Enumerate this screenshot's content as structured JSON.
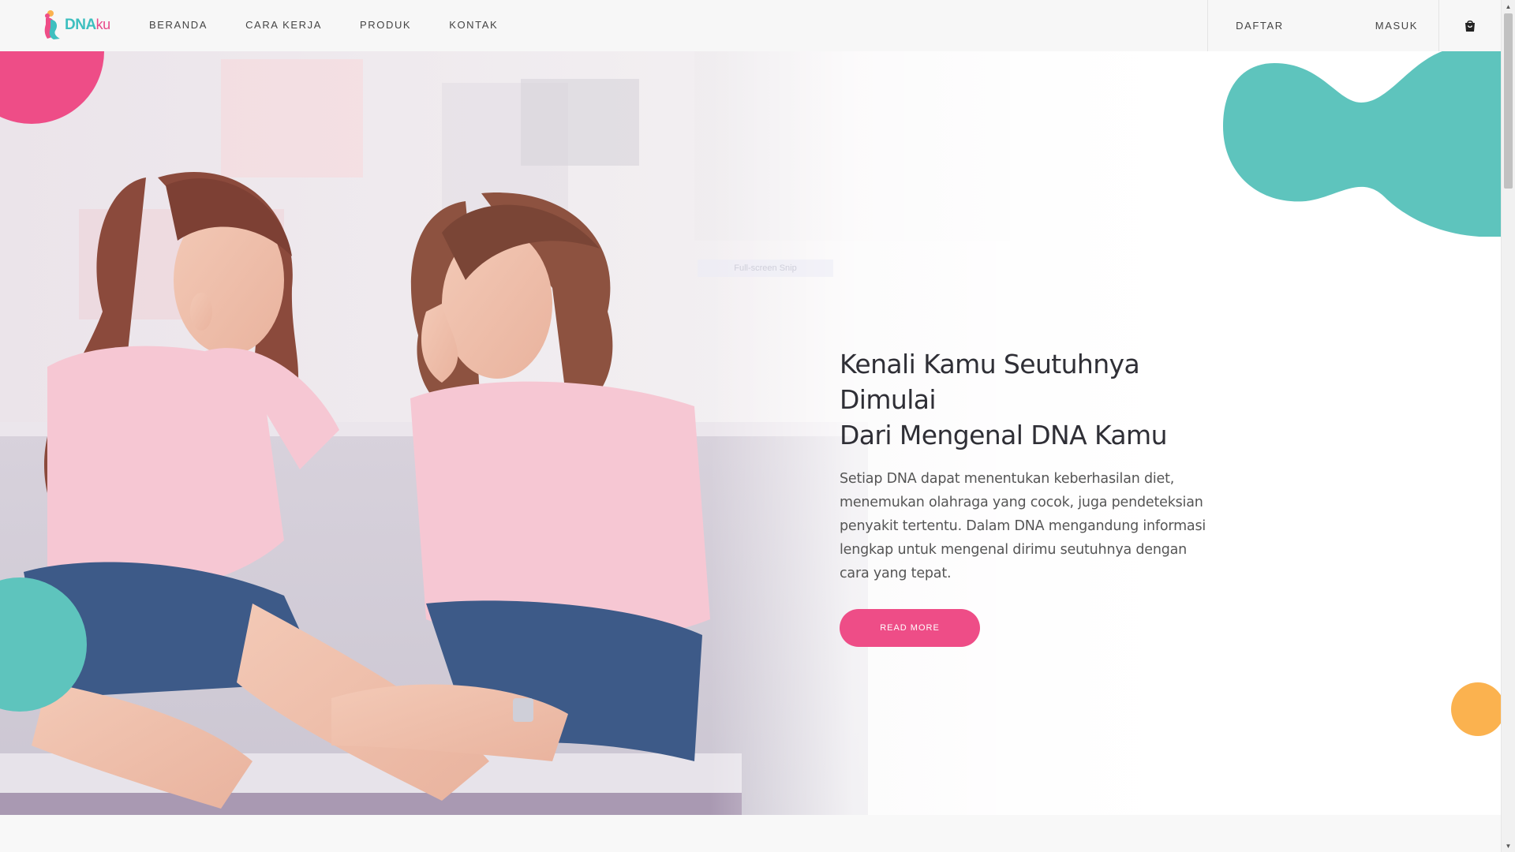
{
  "brand": {
    "name_part1": "DNA",
    "name_part2": "ku"
  },
  "nav": {
    "links": [
      {
        "label": "BERANDA"
      },
      {
        "label": "CARA KERJA"
      },
      {
        "label": "PRODUK"
      },
      {
        "label": "KONTAK"
      }
    ],
    "register_label": "DAFTAR",
    "login_label": "MASUK",
    "cart_icon": "shopping-bag-icon"
  },
  "hero": {
    "snip_label": "Full-screen Snip",
    "title_line1": "Kenali Kamu Seutuhnya Dimulai",
    "title_line2": "Dari Mengenal DNA Kamu",
    "description": "Setiap DNA dapat menentukan keberhasilan diet, menemukan olahraga yang cocok, juga pendeteksian penyakit tertentu. Dalam DNA mengandung informasi lengkap untuk mengenal dirimu seutuhnya dengan cara yang tepat.",
    "button_label": "READ MORE"
  },
  "colors": {
    "accent_pink": "#ee4d87",
    "accent_teal": "#5ec4bd",
    "accent_orange": "#fbb24f",
    "nav_bg": "#f7f7f7"
  }
}
